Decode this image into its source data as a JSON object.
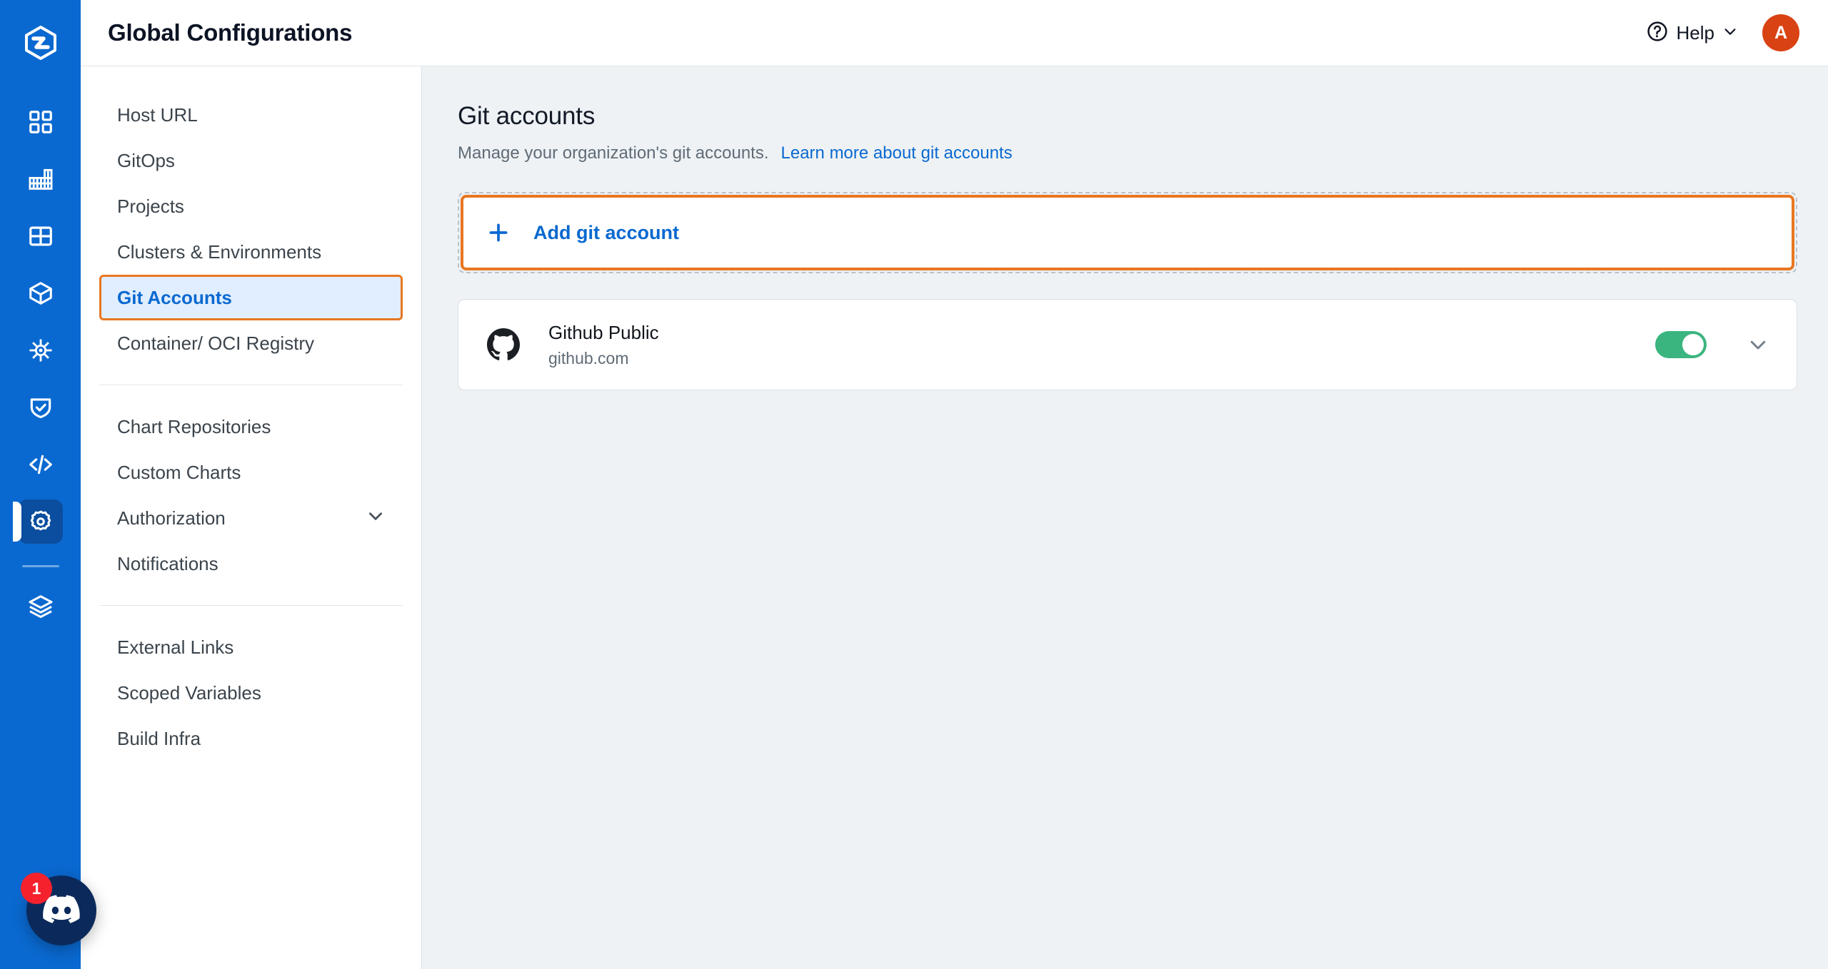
{
  "rail": {
    "logo_name": "devtron-logo",
    "brand_color": "#0a69d0",
    "items": [
      {
        "name": "applications-grid-icon",
        "label": "Applications"
      },
      {
        "name": "jobs-chart-icon",
        "label": "Jobs"
      },
      {
        "name": "app-groups-icon",
        "label": "Application Groups"
      },
      {
        "name": "chart-store-cube-icon",
        "label": "Chart Store"
      },
      {
        "name": "resource-browser-helm-icon",
        "label": "Resource Browser"
      },
      {
        "name": "security-shield-icon",
        "label": "Security"
      },
      {
        "name": "code-bracket-icon",
        "label": "Code"
      },
      {
        "name": "global-configurations-gear-icon",
        "label": "Global Configurations",
        "active": true
      },
      {
        "name": "stack-manager-layers-icon",
        "label": "Stack Manager"
      }
    ],
    "discord": {
      "name": "discord-chat-button",
      "badge_count": "1",
      "color": "#0b2a5b",
      "badge_color": "#f5222d"
    }
  },
  "header": {
    "title": "Global Configurations",
    "help_label": "Help",
    "help_icon": "question-circle-icon",
    "help_chevron": "chevron-down-icon",
    "avatar_initial": "A",
    "avatar_color": "#d94213"
  },
  "sidebar": {
    "groups": [
      {
        "items": [
          {
            "label": "Host URL",
            "name": "sidebar-item-host-url",
            "selected": false,
            "expandable": false
          },
          {
            "label": "GitOps",
            "name": "sidebar-item-gitops",
            "selected": false,
            "expandable": false
          },
          {
            "label": "Projects",
            "name": "sidebar-item-projects",
            "selected": false,
            "expandable": false
          },
          {
            "label": "Clusters & Environments",
            "name": "sidebar-item-clusters-environments",
            "selected": false,
            "expandable": false
          },
          {
            "label": "Git Accounts",
            "name": "sidebar-item-git-accounts",
            "selected": true,
            "expandable": false
          },
          {
            "label": "Container/ OCI Registry",
            "name": "sidebar-item-container-oci-registry",
            "selected": false,
            "expandable": false
          }
        ]
      },
      {
        "items": [
          {
            "label": "Chart Repositories",
            "name": "sidebar-item-chart-repositories",
            "selected": false,
            "expandable": false
          },
          {
            "label": "Custom Charts",
            "name": "sidebar-item-custom-charts",
            "selected": false,
            "expandable": false
          },
          {
            "label": "Authorization",
            "name": "sidebar-item-authorization",
            "selected": false,
            "expandable": true
          },
          {
            "label": "Notifications",
            "name": "sidebar-item-notifications",
            "selected": false,
            "expandable": false
          }
        ]
      },
      {
        "items": [
          {
            "label": "External Links",
            "name": "sidebar-item-external-links",
            "selected": false,
            "expandable": false
          },
          {
            "label": "Scoped Variables",
            "name": "sidebar-item-scoped-variables",
            "selected": false,
            "expandable": false
          },
          {
            "label": "Build Infra",
            "name": "sidebar-item-build-infra",
            "selected": false,
            "expandable": false
          }
        ]
      }
    ]
  },
  "main": {
    "title": "Git accounts",
    "subtitle": "Manage your organization's git accounts.",
    "link_text": "Learn more about git accounts",
    "add_button": {
      "label": "Add git account",
      "icon": "plus-icon",
      "highlight_color": "#e87722",
      "text_color": "#0a69d0"
    },
    "accounts": [
      {
        "name": "Github Public",
        "host": "github.com",
        "icon": "github-icon",
        "enabled": true,
        "toggle_color": "#3bb57f",
        "chevron": "chevron-down-icon"
      }
    ]
  }
}
